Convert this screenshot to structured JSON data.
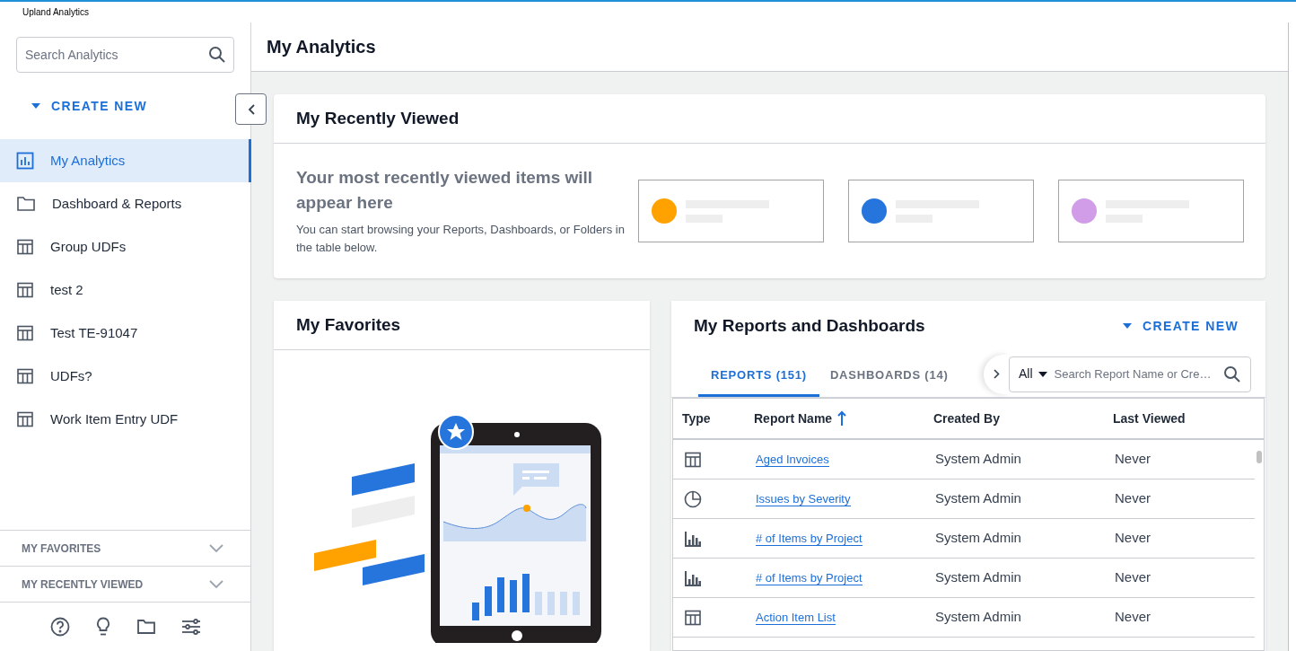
{
  "app_title": "Upland Analytics",
  "sidebar": {
    "search": {
      "placeholder": "Search Analytics"
    },
    "create_new": "CREATE NEW",
    "items": [
      {
        "label": "My Analytics",
        "kind": "chart",
        "selected": true
      },
      {
        "label": "Dashboard & Reports",
        "kind": "folder",
        "selected": false
      },
      {
        "label": "Group UDFs",
        "kind": "table",
        "selected": false
      },
      {
        "label": "test 2",
        "kind": "table",
        "selected": false
      },
      {
        "label": "Test TE-91047",
        "kind": "table",
        "selected": false
      },
      {
        "label": "UDFs?",
        "kind": "table",
        "selected": false
      },
      {
        "label": "Work Item Entry UDF",
        "kind": "table",
        "selected": false
      }
    ],
    "sections": [
      {
        "label": "MY FAVORITES",
        "expanded": false
      },
      {
        "label": "MY RECENTLY VIEWED",
        "expanded": false
      }
    ]
  },
  "page_title": "My Analytics",
  "recently_viewed": {
    "title": "My Recently Viewed",
    "headline": "Your most recently viewed items will appear here",
    "body": "You can start browsing your Reports, Dashboards, or Folders in the table below.",
    "placeholders": [
      {
        "color": "#ffa200"
      },
      {
        "color": "#2675dc"
      },
      {
        "color": "#d29de8"
      }
    ]
  },
  "favorites": {
    "title": "My Favorites"
  },
  "reports": {
    "title": "My Reports and Dashboards",
    "create_new": "CREATE NEW",
    "tabs": [
      {
        "label": "REPORTS (151)",
        "selected": true
      },
      {
        "label": "DASHBOARDS (14)",
        "selected": false
      }
    ],
    "filter": "All",
    "search": {
      "placeholder": "Search Report Name or Cre…"
    },
    "columns": [
      "Type",
      "Report Name",
      "Created By",
      "Last Viewed"
    ],
    "rows": [
      {
        "kind": "table",
        "name": "Aged Invoices",
        "created_by": "System Admin",
        "last_viewed": "Never"
      },
      {
        "kind": "pie",
        "name": "Issues by Severity",
        "created_by": "System Admin",
        "last_viewed": "Never"
      },
      {
        "kind": "bar",
        "name": "# of Items by Project",
        "created_by": "System Admin",
        "last_viewed": "Never"
      },
      {
        "kind": "bar",
        "name": "# of Items by Project",
        "created_by": "System Admin",
        "last_viewed": "Never"
      },
      {
        "kind": "table",
        "name": "Action Item List",
        "created_by": "System Admin",
        "last_viewed": "Never"
      }
    ]
  }
}
